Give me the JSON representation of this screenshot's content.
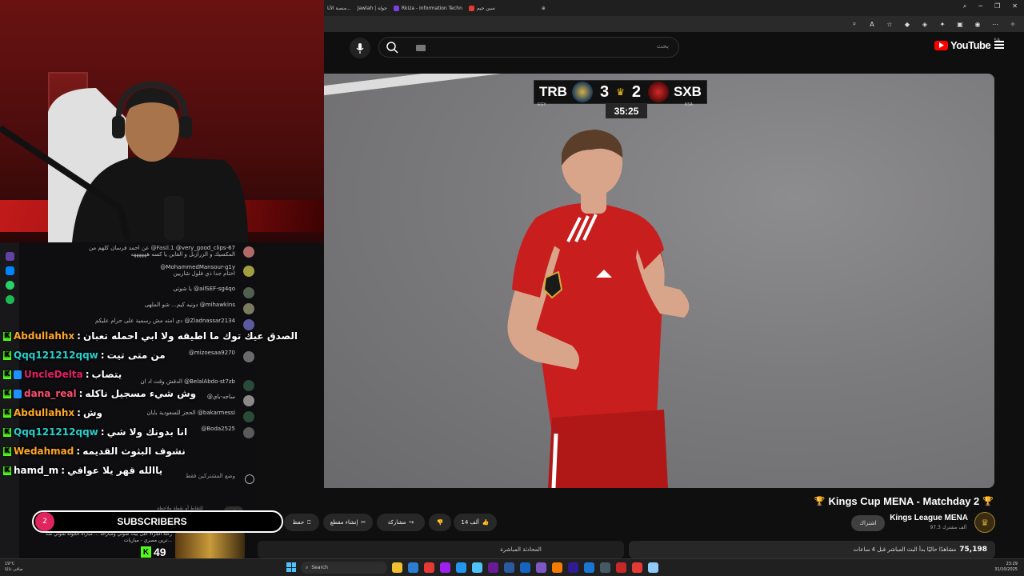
{
  "browser": {
    "tabs": [
      {
        "label": "سين جيم",
        "color": "#e53935"
      },
      {
        "label": "Rkiza - Information Techn",
        "color": "#7b3fe4"
      },
      {
        "label": "Jawlah | جولة",
        "color": "#1e88e5"
      },
      {
        "label": "منصة الأنا...",
        "color": "#555555"
      }
    ],
    "new_tab_icon": "plus-icon"
  },
  "youtube": {
    "search_placeholder": "بحث",
    "logo_text": "YouTube",
    "region": "SA"
  },
  "scoreboard": {
    "home_team": "TRB",
    "home_country": "EGY",
    "home_score": "3",
    "away_team": "SXB",
    "away_country": "KSA",
    "away_score": "2",
    "clock": "35:25"
  },
  "chat_messages": [
    {
      "user": "@very_good_clips-67",
      "text": "عن احمد فرسان كلهم من @Fasil.1",
      "sub": "المكسيك و الزرازيل و القاين يا كسه ههههههه"
    },
    {
      "user": "@MohammedMansour-g1y",
      "text": "الحكم راسححهههه",
      "sub": "اختام جدا ذي فلول شاريين"
    },
    {
      "user": "@ailSEF-sg4qo",
      "text": "يا شوتي"
    },
    {
      "user": "@mihawkins",
      "text": "دونيه كيم... شو الملهى"
    },
    {
      "user": "@Ziadnassar2134",
      "text": "دي امته مش رسمية على حرام عليكم"
    },
    {
      "user": "@mizoesaa9270",
      "text": ""
    },
    {
      "user": "@BelalAbdo-st7zb",
      "text": "الدقش وقت اد ان"
    },
    {
      "user": "@ساجه-باي",
      "text": ""
    },
    {
      "user": "@bakarmessi",
      "text": "الحجز للسعودية بايان"
    },
    {
      "user": "@Boda2525",
      "text": ""
    },
    {
      "user": "",
      "text": "وضع المشتركين فقط"
    }
  ],
  "kick_chat": [
    {
      "user": "Abdullahhx",
      "color": "#ffa726",
      "badge": false,
      "text": "الصدق عيك توك ما اطيقه ولا ابي احمله تعبان"
    },
    {
      "user": "Qqq121212qqw",
      "color": "#26d0ce",
      "badge": false,
      "text": "من متى تيت"
    },
    {
      "user": "UncleDelta",
      "color": "#e91e63",
      "badge": true,
      "text": "يتصاب"
    },
    {
      "user": "dana_real",
      "color": "#ff4d6d",
      "badge": true,
      "text": "وش شيء مسجيل ناكله"
    },
    {
      "user": "Abdullahhx",
      "color": "#ffa726",
      "badge": false,
      "text": "وش"
    },
    {
      "user": "Qqq121212qqw",
      "color": "#26d0ce",
      "badge": false,
      "text": "انا بدونك ولا شي"
    },
    {
      "user": "Wedahmad",
      "color": "#ffa726",
      "badge": false,
      "text": "نشوف البثوث القديمه"
    },
    {
      "user": "hamd_m",
      "color": "#ffffff",
      "badge": false,
      "text": "ياالله قهر يلا عوافي"
    }
  ],
  "overlay": {
    "sub_count": "2",
    "subscribers_label": "SUBSCRIBERS",
    "kick_viewers": "49",
    "thumb_caption": "ركلة الجزاء على بيت شوتي ومباراته ... مباراة الجولة شوتي ضد ترين مصري - مباريات..."
  },
  "video": {
    "title": "Kings Cup MENA - Matchday 2",
    "channel": "Kings League MENA",
    "channel_subs": "97.3 ألف مشترك",
    "subscribe": "اشتراك",
    "likes": "14 ألف",
    "share": "مشاركة",
    "clip": "إنشاء مقطع",
    "save": "حفظ",
    "more": "...",
    "viewer_snippet": "25",
    "views": "75,198",
    "views_suffix": "مشاهدًا حاليًا  بدأ البث المباشر قبل 4 ساعات",
    "live_chat": "المحادثة المباشرة",
    "tool_hint": "للتقاط أو نقطة ملاحظة",
    "tool_tab": "الأهل"
  },
  "taskbar": {
    "weather_temp": "19°C",
    "weather_desc": "صافي غالبًا",
    "search": "Search",
    "time": "23:29",
    "date": "31/10/2025",
    "apps": [
      "#f0c030",
      "#2d7dd2",
      "#e53935",
      "#a020f0",
      "#2496ed",
      "#4fc3f7",
      "#6a1b9a",
      "#2c5aa0",
      "#1565c0",
      "#7e57c2",
      "#f57c00",
      "#311b92",
      "#1976d2",
      "#455a64",
      "#c62828",
      "#e53935",
      "#90caf9"
    ]
  }
}
